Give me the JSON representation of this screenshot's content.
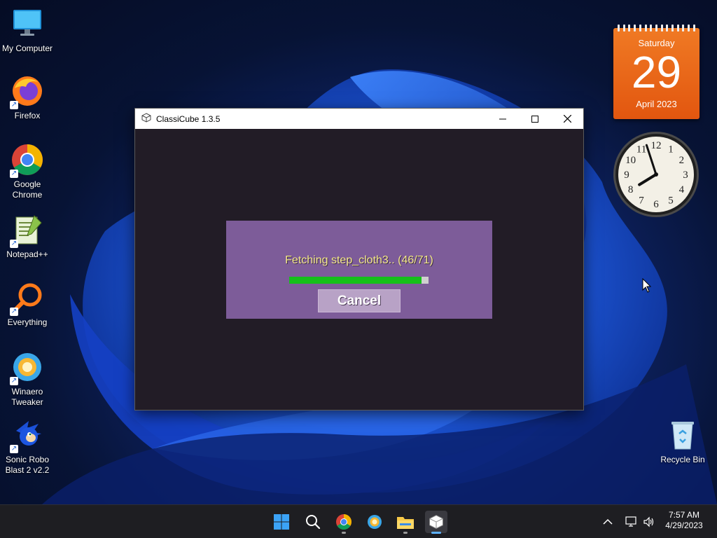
{
  "desktop": {
    "icons": [
      {
        "label": "My Computer"
      },
      {
        "label": "Firefox"
      },
      {
        "label": "Google Chrome"
      },
      {
        "label": "Notepad++"
      },
      {
        "label": "Everything"
      },
      {
        "label": "Winaero Tweaker"
      },
      {
        "label": "Sonic Robo Blast 2 v2.2"
      }
    ],
    "recycle_bin": {
      "label": "Recycle Bin"
    }
  },
  "calendar": {
    "weekday": "Saturday",
    "day": "29",
    "month_year": "April 2023"
  },
  "clock_gadget": {
    "numbers": [
      "12",
      "1",
      "2",
      "3",
      "4",
      "5",
      "6",
      "7",
      "8",
      "9",
      "10",
      "11"
    ],
    "hour": 7,
    "minute": 57
  },
  "window": {
    "title": "ClassiCube 1.3.5",
    "dialog": {
      "status_text": "Fetching step_cloth3.. (46/71)",
      "progress_fraction": 0.95,
      "cancel_label": "Cancel"
    }
  },
  "taskbar": {
    "apps": [
      "start-icon",
      "search-icon",
      "chrome-icon",
      "winaero-icon",
      "file-explorer-icon",
      "classicube-icon"
    ],
    "time": "7:57 AM",
    "date": "4/29/2023"
  },
  "colors": {
    "dialog_bg": "#7d5c99",
    "progress_fill": "#16c01a",
    "status_text": "#f4e88a",
    "calendar": "#e8641a"
  }
}
